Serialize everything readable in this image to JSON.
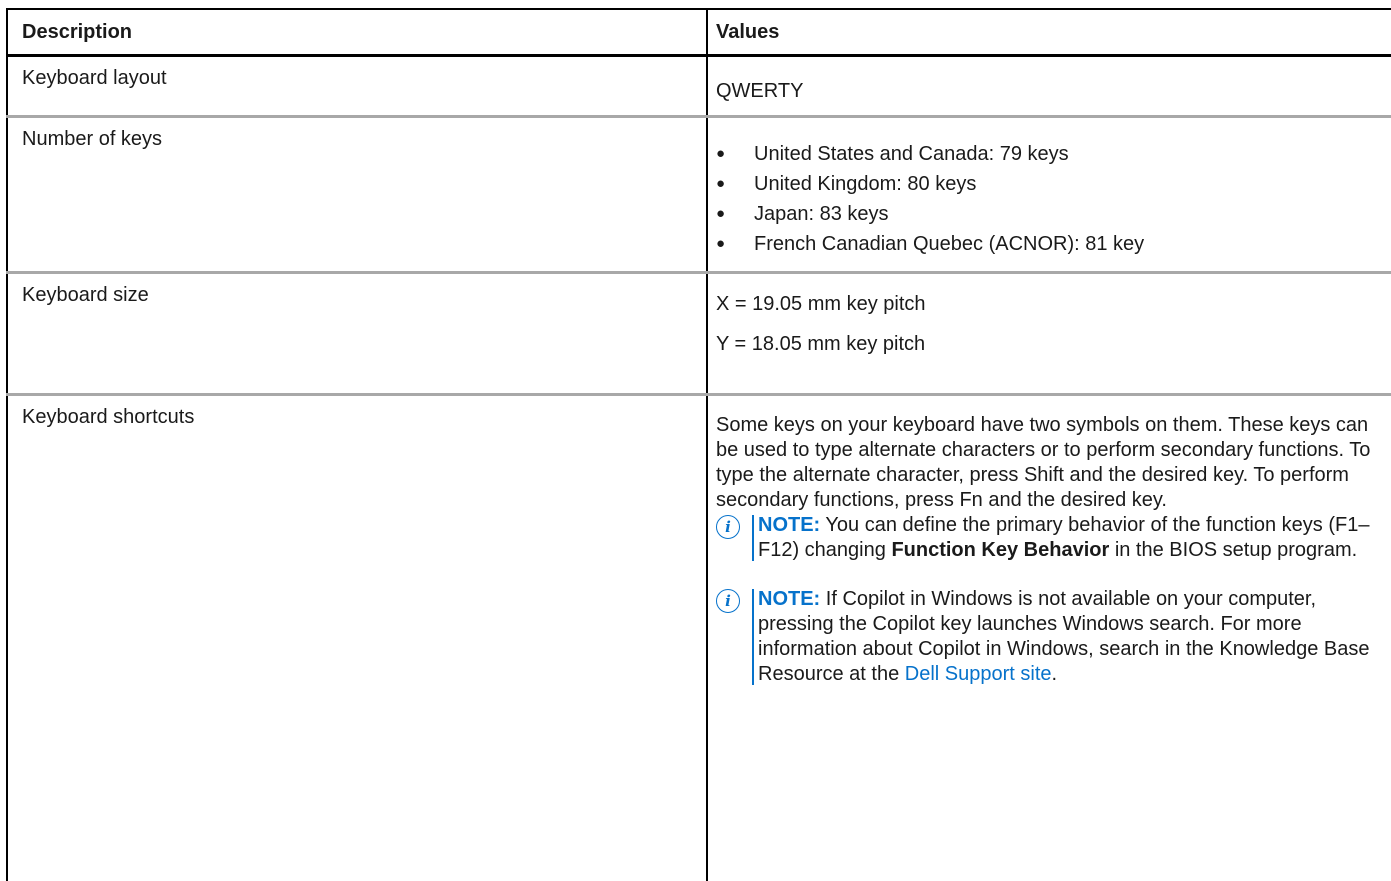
{
  "table": {
    "header": {
      "description": "Description",
      "values": "Values"
    },
    "rows": {
      "layout": {
        "description": "Keyboard layout",
        "value": "QWERTY"
      },
      "keys": {
        "description": "Number of keys",
        "items": [
          "United States and Canada: 79 keys",
          "United Kingdom: 80 keys",
          "Japan: 83 keys",
          "French Canadian Quebec (ACNOR): 81 key"
        ],
        "bullet": "●"
      },
      "size": {
        "description": "Keyboard size",
        "x": "X = 19.05 mm key pitch",
        "y": "Y = 18.05 mm key pitch"
      },
      "shortcuts": {
        "description": "Keyboard shortcuts",
        "paragraph": "Some keys on your keyboard have two symbols on them. These keys can be used to type alternate characters or to perform secondary functions. To type the alternate character, press Shift and the desired key. To perform secondary functions, press Fn and the desired key.",
        "note_icon": "i",
        "note1": {
          "label": "NOTE:",
          "text_before": "You can define the primary behavior of the function keys (F1–F12) changing",
          "bold": "Function Key Behavior",
          "text_after": "in the BIOS setup program."
        },
        "note2": {
          "label": "NOTE:",
          "text_before": "If Copilot in Windows is not available on your computer, pressing the Copilot key launches Windows search. For more information about Copilot in Windows, search in the Knowledge Base Resource at the",
          "link": "Dell Support site",
          "text_after": "."
        }
      }
    }
  },
  "colors": {
    "accent": "#0672cb",
    "row_border": "#a8a8a8",
    "text": "#1a1a1a"
  },
  "icons": {
    "note": "info-circle-icon",
    "bullet": "bullet-dot-icon"
  }
}
